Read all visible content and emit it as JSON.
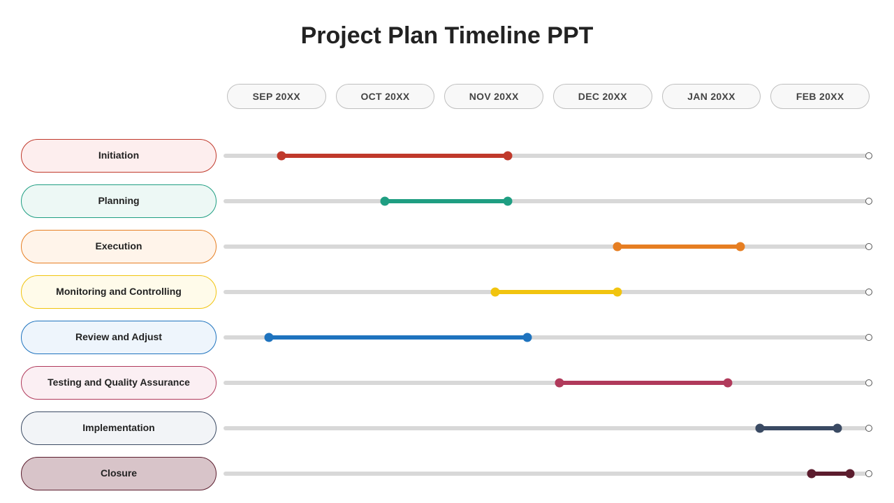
{
  "title": "Project Plan Timeline PPT",
  "months": [
    "SEP 20XX",
    "OCT 20XX",
    "NOV 20XX",
    "DEC 20XX",
    "JAN 20XX",
    "FEB 20XX"
  ],
  "chart_data": {
    "type": "gantt",
    "time_axis": [
      "SEP 20XX",
      "OCT 20XX",
      "NOV 20XX",
      "DEC 20XX",
      "JAN 20XX",
      "FEB 20XX"
    ],
    "tasks": [
      {
        "name": "Initiation",
        "color": "#c0392b",
        "fill": "#fdeeee",
        "start_pct": 9,
        "end_pct": 44
      },
      {
        "name": "Planning",
        "color": "#1f9e82",
        "fill": "#edf8f5",
        "start_pct": 25,
        "end_pct": 44
      },
      {
        "name": "Execution",
        "color": "#e67e22",
        "fill": "#fff4ea",
        "start_pct": 61,
        "end_pct": 80
      },
      {
        "name": "Monitoring and Controlling",
        "color": "#f1c40f",
        "fill": "#fffbea",
        "start_pct": 42,
        "end_pct": 61
      },
      {
        "name": "Review and Adjust",
        "color": "#1e73be",
        "fill": "#eef5fc",
        "start_pct": 7,
        "end_pct": 47
      },
      {
        "name": "Testing and Quality Assurance",
        "color": "#b03a5b",
        "fill": "#fbeff3",
        "start_pct": 52,
        "end_pct": 78
      },
      {
        "name": "Implementation",
        "color": "#3a4a63",
        "fill": "#f2f4f7",
        "start_pct": 83,
        "end_pct": 95
      },
      {
        "name": "Closure",
        "color": "#5c1d2e",
        "fill": "#d8c4c9",
        "start_pct": 91,
        "end_pct": 97
      }
    ]
  }
}
